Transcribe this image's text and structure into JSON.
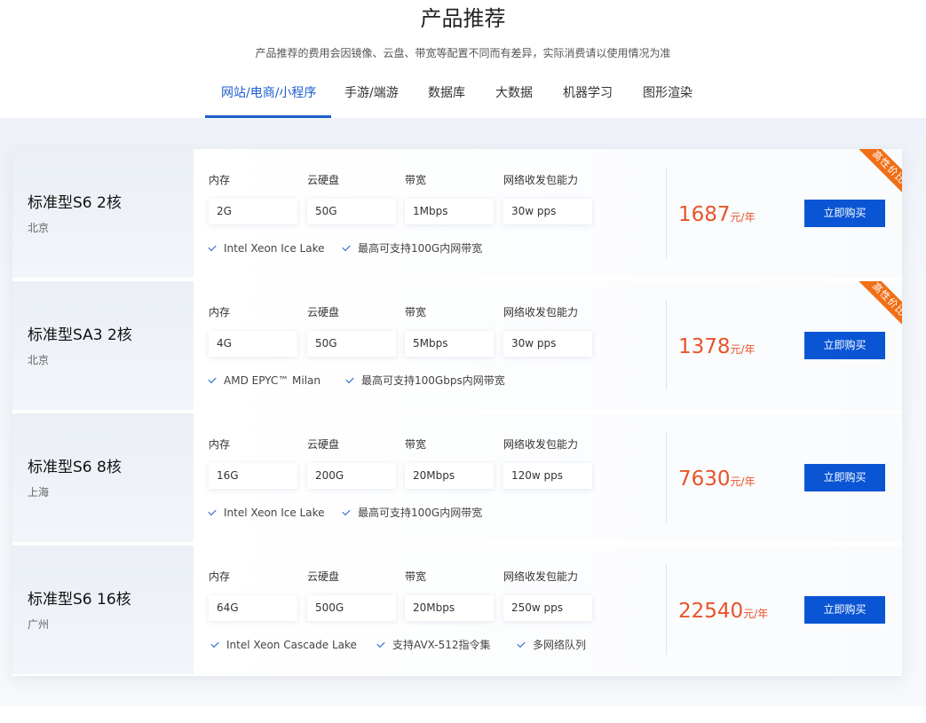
{
  "header": {
    "title": "产品推荐",
    "subtitle": "产品推荐的费用会因镜像、云盘、带宽等配置不同而有差异，实际消费请以使用情况为准"
  },
  "tabs": [
    {
      "label": "网站/电商/小程序",
      "active": true
    },
    {
      "label": "手游/端游",
      "active": false
    },
    {
      "label": "数据库",
      "active": false
    },
    {
      "label": "大数据",
      "active": false
    },
    {
      "label": "机器学习",
      "active": false
    },
    {
      "label": "图形渲染",
      "active": false
    }
  ],
  "spec_labels": {
    "memory": "内存",
    "disk": "云硬盘",
    "bandwidth": "带宽",
    "pps": "网络收发包能力"
  },
  "colors": {
    "accent": "#1d5fcc",
    "button": "#0a55d4",
    "price": "#e8542a",
    "ribbon": "#f06f17"
  },
  "products": [
    {
      "name": "标准型S6 2核",
      "region": "北京",
      "memory": "2G",
      "disk": "50G",
      "bandwidth": "1Mbps",
      "pps": "30w pps",
      "features": [
        "Intel Xeon Ice Lake",
        "最高可支持100G内网带宽"
      ],
      "price": "1687",
      "unit": "元/年",
      "buy_label": "立即购买",
      "ribbon": "高性价比"
    },
    {
      "name": "标准型SA3 2核",
      "region": "北京",
      "memory": "4G",
      "disk": "50G",
      "bandwidth": "5Mbps",
      "pps": "30w pps",
      "features": [
        "AMD EPYC™ Milan",
        "最高可支持100Gbps内网带宽"
      ],
      "price": "1378",
      "unit": "元/年",
      "buy_label": "立即购买",
      "ribbon": "高性价比"
    },
    {
      "name": "标准型S6 8核",
      "region": "上海",
      "memory": "16G",
      "disk": "200G",
      "bandwidth": "20Mbps",
      "pps": "120w pps",
      "features": [
        "Intel Xeon Ice Lake",
        "最高可支持100G内网带宽"
      ],
      "price": "7630",
      "unit": "元/年",
      "buy_label": "立即购买",
      "ribbon": ""
    },
    {
      "name": "标准型S6 16核",
      "region": "广州",
      "memory": "64G",
      "disk": "500G",
      "bandwidth": "20Mbps",
      "pps": "250w pps",
      "features": [
        "Intel Xeon Cascade Lake",
        "支持AVX-512指令集",
        "多网络队列"
      ],
      "price": "22540",
      "unit": "元/年",
      "buy_label": "立即购买",
      "ribbon": ""
    }
  ]
}
